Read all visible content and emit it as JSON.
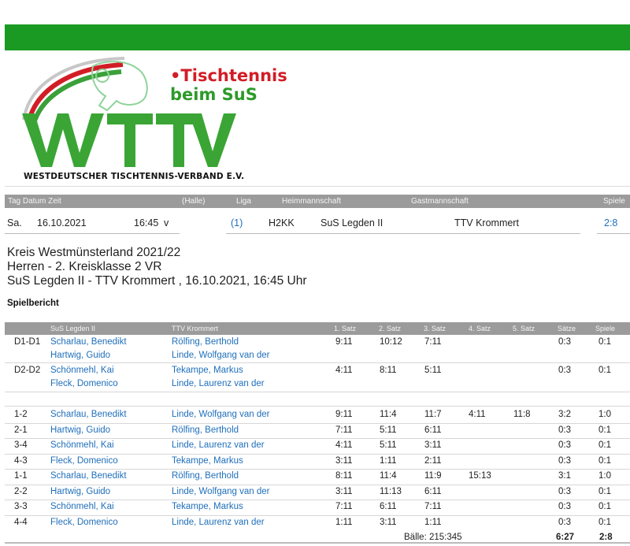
{
  "logo": {
    "slogan_line1": "•Tischtennis",
    "slogan_line2": "beim SuS",
    "letters": "WTTV",
    "subtitle": "WESTDEUTSCHER TISCHTENNIS-VERBAND E.V."
  },
  "match_header": {
    "columns": [
      "Tag Datum Zeit",
      "(Halle)",
      "Liga",
      "Heimmannschaft",
      "Gastmannschaft",
      "Spiele"
    ]
  },
  "match": {
    "day": "Sa.",
    "date": "16.10.2021",
    "time": "16:45",
    "flag": "v",
    "hall": "(1)",
    "league": "H2KK",
    "home": "SuS Legden II",
    "guest": "TTV Krommert",
    "score": "2:8"
  },
  "titles": {
    "line1": "Kreis Westmünsterland 2021/22",
    "line2": "Herren - 2. Kreisklasse 2 VR",
    "line3": "SuS Legden II - TTV Krommert , 16.10.2021, 16:45 Uhr"
  },
  "report_label": "Spielbericht",
  "table_header": {
    "home": "SuS Legden II",
    "guest": "TTV Krommert",
    "s1": "1. Satz",
    "s2": "2. Satz",
    "s3": "3. Satz",
    "s4": "4. Satz",
    "s5": "5. Satz",
    "sets": "Sätze",
    "games": "Spiele"
  },
  "doubles": [
    {
      "pos": "D1-D1",
      "home1": "Scharlau, Benedikt",
      "home2": "Hartwig, Guido",
      "guest1": "Rölfing, Berthold",
      "guest2": "Linde, Wolfgang van der",
      "s1": "9:11",
      "s2": "10:12",
      "s3": "7:11",
      "s4": "",
      "s5": "",
      "sets": "0:3",
      "games": "0:1"
    },
    {
      "pos": "D2-D2",
      "home1": "Schönmehl, Kai",
      "home2": "Fleck, Domenico",
      "guest1": "Tekampe, Markus",
      "guest2": "Linde, Laurenz van der",
      "s1": "4:11",
      "s2": "8:11",
      "s3": "5:11",
      "s4": "",
      "s5": "",
      "sets": "0:3",
      "games": "0:1"
    }
  ],
  "singles": [
    {
      "pos": "1-2",
      "home": "Scharlau, Benedikt",
      "guest": "Linde, Wolfgang van der",
      "s1": "9:11",
      "s2": "11:4",
      "s3": "11:7",
      "s4": "4:11",
      "s5": "11:8",
      "sets": "3:2",
      "games": "1:0"
    },
    {
      "pos": "2-1",
      "home": "Hartwig, Guido",
      "guest": "Rölfing, Berthold",
      "s1": "7:11",
      "s2": "5:11",
      "s3": "6:11",
      "s4": "",
      "s5": "",
      "sets": "0:3",
      "games": "0:1"
    },
    {
      "pos": "3-4",
      "home": "Schönmehl, Kai",
      "guest": "Linde, Laurenz van der",
      "s1": "4:11",
      "s2": "5:11",
      "s3": "3:11",
      "s4": "",
      "s5": "",
      "sets": "0:3",
      "games": "0:1"
    },
    {
      "pos": "4-3",
      "home": "Fleck, Domenico",
      "guest": "Tekampe, Markus",
      "s1": "3:11",
      "s2": "1:11",
      "s3": "2:11",
      "s4": "",
      "s5": "",
      "sets": "0:3",
      "games": "0:1"
    },
    {
      "pos": "1-1",
      "home": "Scharlau, Benedikt",
      "guest": "Rölfing, Berthold",
      "s1": "8:11",
      "s2": "11:4",
      "s3": "11:9",
      "s4": "15:13",
      "s5": "",
      "sets": "3:1",
      "games": "1:0"
    },
    {
      "pos": "2-2",
      "home": "Hartwig, Guido",
      "guest": "Linde, Wolfgang van der",
      "s1": "3:11",
      "s2": "11:13",
      "s3": "6:11",
      "s4": "",
      "s5": "",
      "sets": "0:3",
      "games": "0:1"
    },
    {
      "pos": "3-3",
      "home": "Schönmehl, Kai",
      "guest": "Tekampe, Markus",
      "s1": "7:11",
      "s2": "6:11",
      "s3": "7:11",
      "s4": "",
      "s5": "",
      "sets": "0:3",
      "games": "0:1"
    },
    {
      "pos": "4-4",
      "home": "Fleck, Domenico",
      "guest": "Linde, Laurenz van der",
      "s1": "1:11",
      "s2": "3:11",
      "s3": "1:11",
      "s4": "",
      "s5": "",
      "sets": "0:3",
      "games": "0:1"
    }
  ],
  "totals": {
    "balls": "Bälle: 215:345",
    "sets": "6:27",
    "games": "2:8"
  },
  "colors": {
    "brand_green": "#1a9a23",
    "header_gray": "#9b9b9b",
    "link_blue": "#1f6fba",
    "logo_red": "#d21d26"
  }
}
